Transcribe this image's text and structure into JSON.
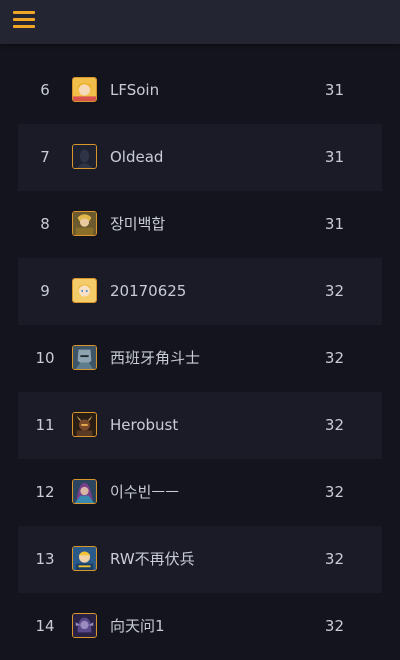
{
  "header": {
    "menu_icon": "hamburger-menu-icon",
    "accent_color": "#f0a526"
  },
  "leaderboard": {
    "rows": [
      {
        "rank": "6",
        "name": "LFSoin",
        "score": "31",
        "avatar": "blonde-girl-portrait-icon"
      },
      {
        "rank": "7",
        "name": "Oldead",
        "score": "31",
        "avatar": "dark-silhouette-portrait-icon"
      },
      {
        "rank": "8",
        "name": "장미백합",
        "score": "31",
        "avatar": "gold-armored-warrior-portrait-icon"
      },
      {
        "rank": "9",
        "name": "20170625",
        "score": "32",
        "avatar": "blonde-girl-portrait-icon"
      },
      {
        "rank": "10",
        "name": "西班牙角斗士",
        "score": "32",
        "avatar": "armored-knight-portrait-icon"
      },
      {
        "rank": "11",
        "name": "Herobust",
        "score": "32",
        "avatar": "horned-warrior-portrait-icon"
      },
      {
        "rank": "12",
        "name": "이수빈ㅡㅡ",
        "score": "32",
        "avatar": "sorceress-portrait-icon"
      },
      {
        "rank": "13",
        "name": "RW不再伏兵",
        "score": "32",
        "avatar": "cartoon-character-portrait-icon"
      },
      {
        "rank": "14",
        "name": "向天问1",
        "score": "32",
        "avatar": "dark-elf-portrait-icon"
      }
    ]
  }
}
